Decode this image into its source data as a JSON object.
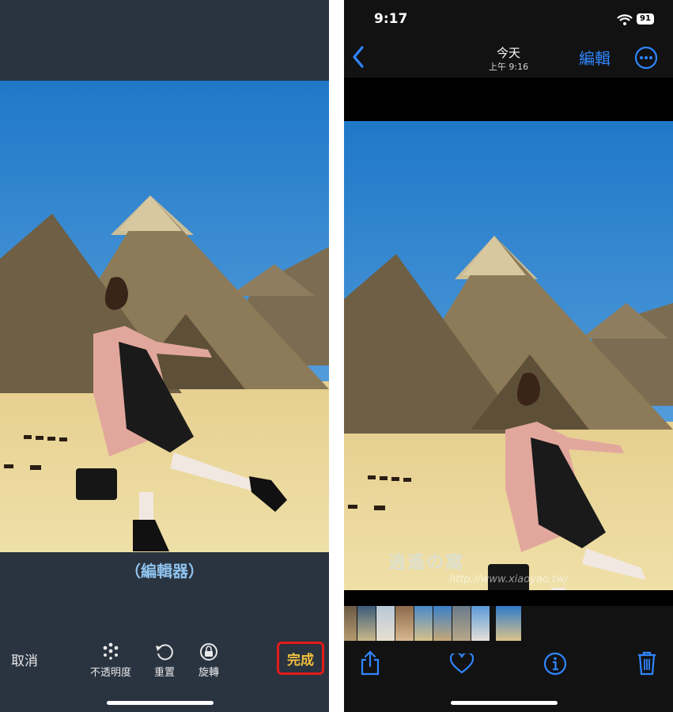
{
  "left_panel": {
    "caption": "（編輯器）",
    "cancel_label": "取消",
    "tools": [
      {
        "label": "不透明度",
        "icon": "opacity-dots-icon"
      },
      {
        "label": "重置",
        "icon": "reset-rotate-icon"
      },
      {
        "label": "旋轉",
        "icon": "rotate-lock-icon"
      }
    ],
    "done_label": "完成"
  },
  "right_panel": {
    "status_time": "9:17",
    "battery": "91",
    "title": "今天",
    "subtitle": "上午 9:16",
    "edit_label": "編輯",
    "watermark_title": "逍遙の窩",
    "watermark_url": "http://www.xiaoyao.tw/",
    "toolbar_icons": [
      "share-icon",
      "heart-icon",
      "info-icon",
      "trash-icon"
    ]
  },
  "colors": {
    "accent_blue": "#2f86ff",
    "done_yellow": "#f2c03b",
    "highlight_red": "#e21b1b",
    "caption_blue": "#8fc3ee"
  }
}
